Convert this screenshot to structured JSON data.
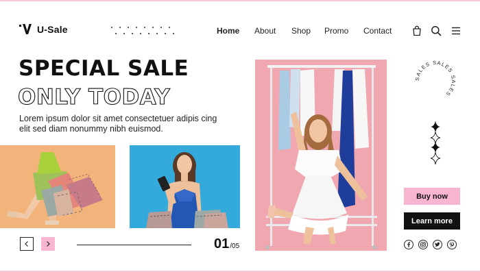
{
  "brand": {
    "name": "U-Sale"
  },
  "nav": {
    "items": [
      {
        "label": "Home",
        "active": true
      },
      {
        "label": "About",
        "active": false
      },
      {
        "label": "Shop",
        "active": false
      },
      {
        "label": "Promo",
        "active": false
      },
      {
        "label": "Contact",
        "active": false
      }
    ]
  },
  "header_icons": [
    "shopping-bag-icon",
    "search-icon",
    "menu-icon"
  ],
  "hero": {
    "title_line1": "SPECIAL SALE",
    "title_line2": "ONLY TODAY",
    "description": "Lorem ipsum dolor sit amet consectetuer adipis cing elit sed diam nonummy nibh euismod."
  },
  "badge": {
    "text": "SALES SALES SALES "
  },
  "slider": {
    "current": "01",
    "total": "/05"
  },
  "buttons": {
    "buy": "Buy now",
    "learn": "Learn more"
  },
  "socials": [
    "facebook-icon",
    "instagram-icon",
    "twitter-icon",
    "pinterest-icon"
  ],
  "colors": {
    "accent_pink": "#f7b5d2",
    "dark": "#111111",
    "photo_orange": "#f5b981",
    "photo_blue": "#33a9dc",
    "photo_pink": "#f0a7b0"
  }
}
